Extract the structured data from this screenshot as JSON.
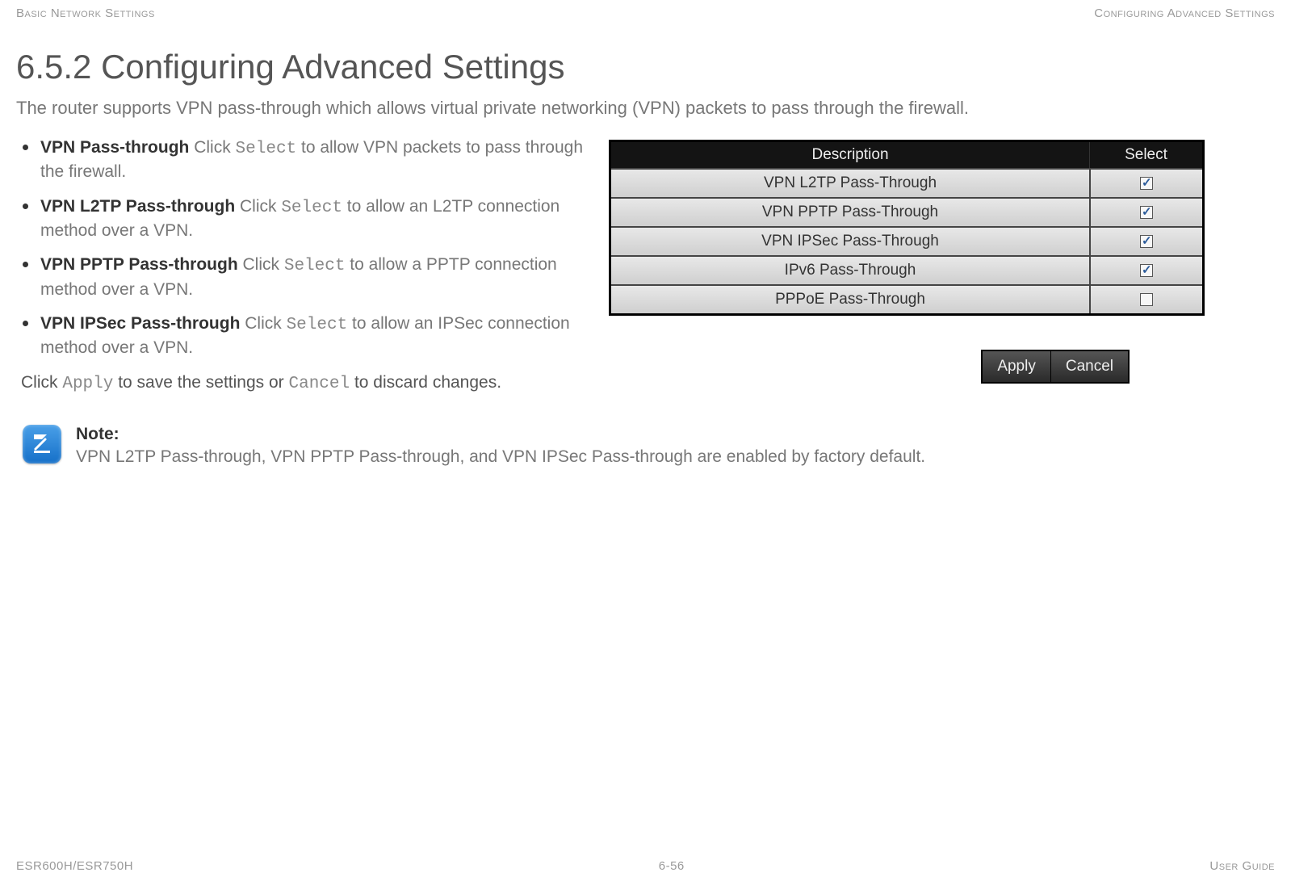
{
  "header": {
    "left": "Basic Network Settings",
    "right": "Configuring Advanced Settings"
  },
  "title": "6.5.2 Configuring Advanced Settings",
  "intro": "The router supports VPN pass-through which allows virtual private networking (VPN) packets to pass through the firewall.",
  "definitions": [
    {
      "term": "VPN Pass-through",
      "pre": "  Click ",
      "code": "Select",
      "post": " to allow VPN packets to pass through the firewall."
    },
    {
      "term": "VPN L2TP Pass-through",
      "pre": "  Click ",
      "code": "Select",
      "post": " to allow an L2TP connection method over a VPN."
    },
    {
      "term": "VPN PPTP Pass-through",
      "pre": "  Click ",
      "code": "Select",
      "post": " to allow a PPTP connection method over a VPN."
    },
    {
      "term": "VPN IPSec Pass-through",
      "pre": "  Click ",
      "code": "Select",
      "post": " to allow an IPSec connection method over a VPN."
    }
  ],
  "apply_sentence": {
    "pre": "Click ",
    "code1": "Apply",
    "mid": " to save the settings or ",
    "code2": "Cancel",
    "post": " to discard changes."
  },
  "table": {
    "headers": {
      "desc": "Description",
      "select": "Select"
    },
    "rows": [
      {
        "desc": "VPN L2TP Pass-Through",
        "checked": true
      },
      {
        "desc": "VPN PPTP Pass-Through",
        "checked": true
      },
      {
        "desc": "VPN IPSec Pass-Through",
        "checked": true
      },
      {
        "desc": "IPv6 Pass-Through",
        "checked": true
      },
      {
        "desc": "PPPoE Pass-Through",
        "checked": false
      }
    ]
  },
  "buttons": {
    "apply": "Apply",
    "cancel": "Cancel"
  },
  "note": {
    "label": "Note:",
    "text": "VPN L2TP Pass-through, VPN PPTP Pass-through, and VPN IPSec Pass-through are enabled by factory default."
  },
  "footer": {
    "left": "ESR600H/ESR750H",
    "center": "6-56",
    "right": "User Guide"
  }
}
